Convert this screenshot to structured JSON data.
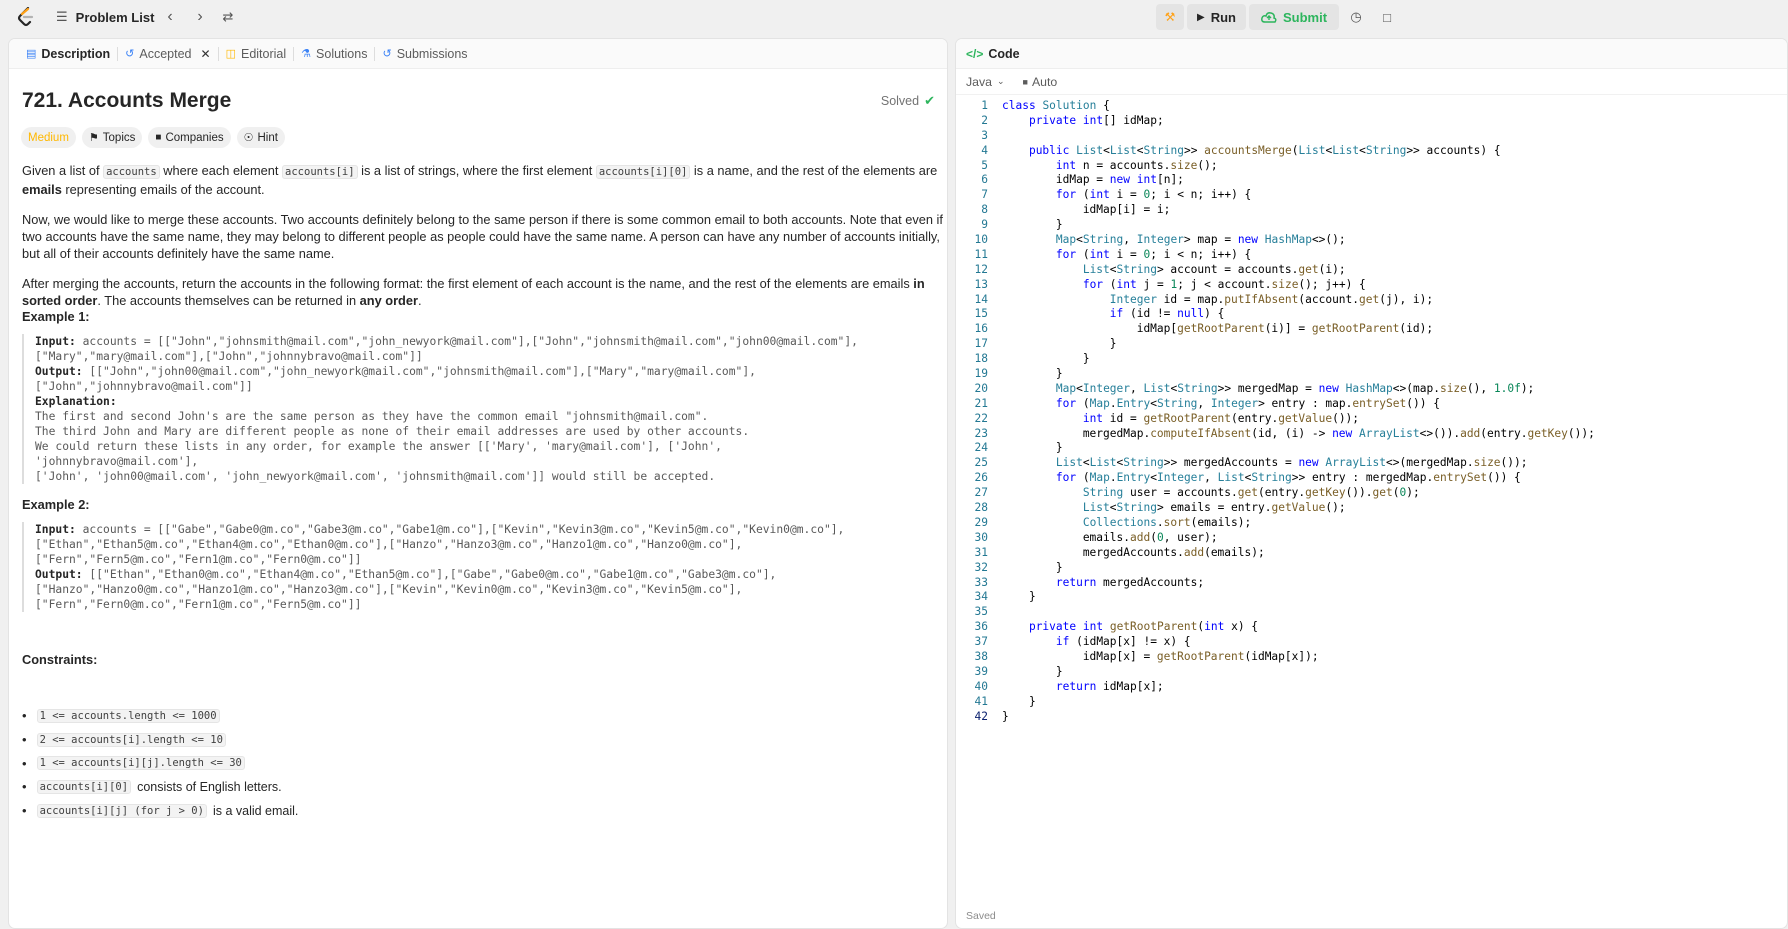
{
  "topbar": {
    "problem_list": "Problem List",
    "run": "Run",
    "submit": "Submit"
  },
  "tabs": [
    {
      "label": "Description",
      "icon": "doc-icon"
    },
    {
      "label": "Accepted",
      "icon": "history-icon"
    },
    {
      "label": "Editorial",
      "icon": "book-icon"
    },
    {
      "label": "Solutions",
      "icon": "flask-icon"
    },
    {
      "label": "Submissions",
      "icon": "clock-icon"
    }
  ],
  "problem": {
    "title": "721. Accounts Merge",
    "status": "Solved",
    "difficulty": "Medium",
    "chips": [
      "Topics",
      "Companies",
      "Hint"
    ]
  },
  "description": {
    "p1a": "Given a list of ",
    "p1_code1": "accounts",
    "p1b": " where each element ",
    "p1_code2": "accounts[i]",
    "p1c": " is a list of strings, where the first element ",
    "p1_code3": "accounts[i][0]",
    "p1d": " is a name, and the rest of the elements are ",
    "p1_bold": "emails",
    "p1e": " representing emails of the account.",
    "p2": "Now, we would like to merge these accounts. Two accounts definitely belong to the same person if there is some common email to both accounts. Note that even if two accounts have the same name, they may belong to different people as people could have the same name. A person can have any number of accounts initially, but all of their accounts definitely have the same name.",
    "p3a": "After merging the accounts, return the accounts in the following format: the first element of each account is the name, and the rest of the elements are emails ",
    "p3_bold1": "in sorted order",
    "p3b": ". The accounts themselves can be returned in ",
    "p3_bold2": "any order",
    "p3c": "."
  },
  "examples": {
    "ex1_title": "Example 1:",
    "ex1_input_label": "Input:",
    "ex1_input": " accounts = [[\"John\",\"johnsmith@mail.com\",\"john_newyork@mail.com\"],[\"John\",\"johnsmith@mail.com\",\"john00@mail.com\"],\n[\"Mary\",\"mary@mail.com\"],[\"John\",\"johnnybravo@mail.com\"]]",
    "ex1_output_label": "Output:",
    "ex1_output": " [[\"John\",\"john00@mail.com\",\"john_newyork@mail.com\",\"johnsmith@mail.com\"],[\"Mary\",\"mary@mail.com\"],\n[\"John\",\"johnnybravo@mail.com\"]]",
    "ex1_expl_label": "Explanation:",
    "ex1_expl": "The first and second John's are the same person as they have the common email \"johnsmith@mail.com\".\nThe third John and Mary are different people as none of their email addresses are used by other accounts.\nWe could return these lists in any order, for example the answer [['Mary', 'mary@mail.com'], ['John',\n'johnnybravo@mail.com'],\n['John', 'john00@mail.com', 'john_newyork@mail.com', 'johnsmith@mail.com']] would still be accepted.",
    "ex2_title": "Example 2:",
    "ex2_input_label": "Input:",
    "ex2_input": " accounts = [[\"Gabe\",\"Gabe0@m.co\",\"Gabe3@m.co\",\"Gabe1@m.co\"],[\"Kevin\",\"Kevin3@m.co\",\"Kevin5@m.co\",\"Kevin0@m.co\"],\n[\"Ethan\",\"Ethan5@m.co\",\"Ethan4@m.co\",\"Ethan0@m.co\"],[\"Hanzo\",\"Hanzo3@m.co\",\"Hanzo1@m.co\",\"Hanzo0@m.co\"],\n[\"Fern\",\"Fern5@m.co\",\"Fern1@m.co\",\"Fern0@m.co\"]]",
    "ex2_output_label": "Output:",
    "ex2_output": " [[\"Ethan\",\"Ethan0@m.co\",\"Ethan4@m.co\",\"Ethan5@m.co\"],[\"Gabe\",\"Gabe0@m.co\",\"Gabe1@m.co\",\"Gabe3@m.co\"],\n[\"Hanzo\",\"Hanzo0@m.co\",\"Hanzo1@m.co\",\"Hanzo3@m.co\"],[\"Kevin\",\"Kevin0@m.co\",\"Kevin3@m.co\",\"Kevin5@m.co\"],\n[\"Fern\",\"Fern0@m.co\",\"Fern1@m.co\",\"Fern5@m.co\"]]"
  },
  "constraints": {
    "title": "Constraints:",
    "c1": "1 <= accounts.length <= 1000",
    "c2": "2 <= accounts[i].length <= 10",
    "c3": "1 <= accounts[i][j].length <= 30",
    "c4_code": "accounts[i][0]",
    "c4_text": " consists of English letters.",
    "c5_code": "accounts[i][j] (for j > 0)",
    "c5_text": " is a valid email."
  },
  "editor": {
    "header": "Code",
    "language": "Java",
    "mode": "Auto",
    "status": "Saved",
    "lines": [
      "class Solution {",
      "    private int[] idMap;",
      "",
      "    public List<List<String>> accountsMerge(List<List<String>> accounts) {",
      "        int n = accounts.size();",
      "        idMap = new int[n];",
      "        for (int i = 0; i < n; i++) {",
      "            idMap[i] = i;",
      "        }",
      "        Map<String, Integer> map = new HashMap<>();",
      "        for (int i = 0; i < n; i++) {",
      "            List<String> account = accounts.get(i);",
      "            for (int j = 1; j < account.size(); j++) {",
      "                Integer id = map.putIfAbsent(account.get(j), i);",
      "                if (id != null) {",
      "                    idMap[getRootParent(i)] = getRootParent(id);",
      "                }",
      "            }",
      "        }",
      "        Map<Integer, List<String>> mergedMap = new HashMap<>(map.size(), 1.0f);",
      "        for (Map.Entry<String, Integer> entry : map.entrySet()) {",
      "            int id = getRootParent(entry.getValue());",
      "            mergedMap.computeIfAbsent(id, (i) -> new ArrayList<>()).add(entry.getKey());",
      "        }",
      "        List<List<String>> mergedAccounts = new ArrayList<>(mergedMap.size());",
      "        for (Map.Entry<Integer, List<String>> entry : mergedMap.entrySet()) {",
      "            String user = accounts.get(entry.getKey()).get(0);",
      "            List<String> emails = entry.getValue();",
      "            Collections.sort(emails);",
      "            emails.add(0, user);",
      "            mergedAccounts.add(emails);",
      "        }",
      "        return mergedAccounts;",
      "    }",
      "",
      "    private int getRootParent(int x) {",
      "        if (idMap[x] != x) {",
      "            idMap[x] = getRootParent(idMap[x]);",
      "        }",
      "        return idMap[x];",
      "    }",
      "}"
    ]
  },
  "colors": {
    "accent_green": "#2db55d",
    "medium": "#ffb800",
    "line_number": "#237893"
  }
}
